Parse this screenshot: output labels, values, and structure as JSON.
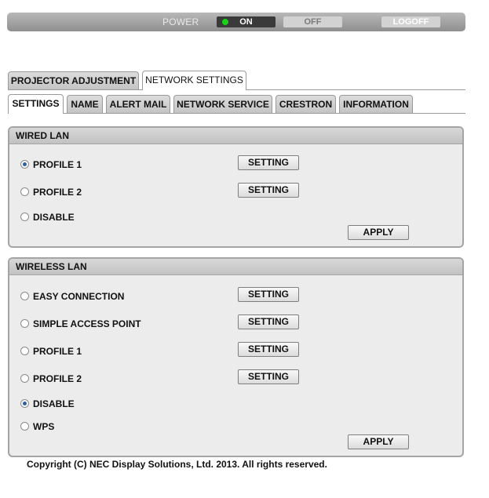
{
  "power": {
    "label": "POWER",
    "on": "ON",
    "off": "OFF",
    "logoff": "LOGOFF",
    "on_led_color": "#19d319"
  },
  "tabs_main": [
    "PROJECTOR ADJUSTMENT",
    "NETWORK SETTINGS"
  ],
  "tabs_sub": [
    "SETTINGS",
    "NAME",
    "ALERT MAIL",
    "NETWORK SERVICE",
    "CRESTRON",
    "INFORMATION"
  ],
  "wired": {
    "title": "WIRED LAN",
    "options": [
      "PROFILE 1",
      "PROFILE 2",
      "DISABLE"
    ],
    "selected": "PROFILE 1",
    "setting_label": "SETTING",
    "apply_label": "APPLY"
  },
  "wireless": {
    "title": "WIRELESS LAN",
    "options": [
      "EASY CONNECTION",
      "SIMPLE ACCESS POINT",
      "PROFILE 1",
      "PROFILE 2",
      "DISABLE",
      "WPS"
    ],
    "selected": "DISABLE",
    "setting_label": "SETTING",
    "apply_label": "APPLY"
  },
  "copyright": "Copyright (C) NEC Display Solutions, Ltd. 2013. All rights reserved."
}
